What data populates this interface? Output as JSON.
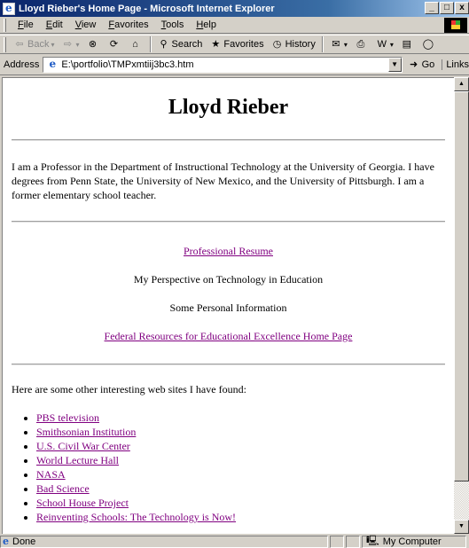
{
  "window": {
    "title": "Lloyd Rieber's Home Page - Microsoft Internet Explorer",
    "min": "_",
    "max": "□",
    "close": "x"
  },
  "menu": [
    "File",
    "Edit",
    "View",
    "Favorites",
    "Tools",
    "Help"
  ],
  "toolbar": {
    "back": "Back",
    "search": "Search",
    "favorites": "Favorites",
    "history": "History"
  },
  "address": {
    "label": "Address",
    "url": "E:\\portfolio\\TMPxmtiij3bc3.htm",
    "go": "Go",
    "links": "Links"
  },
  "page": {
    "heading": "Lloyd Rieber",
    "intro": "I am a Professor in the Department of Instructional Technology at the University of Georgia. I have degrees from Penn State, the University of New Mexico, and the University of Pittsburgh. I am a former elementary school teacher.",
    "center_items": [
      {
        "text": "Professional Resume",
        "link": true
      },
      {
        "text": "My Perspective on Technology in Education",
        "link": false
      },
      {
        "text": "Some Personal Information",
        "link": false
      },
      {
        "text": "Federal Resources for Educational Excellence Home Page",
        "link": true
      }
    ],
    "others_intro": "Here are some other interesting web sites I have found:",
    "sites": [
      "PBS television",
      "Smithsonian Institution",
      "U.S. Civil War Center",
      "World Lecture Hall",
      "NASA",
      "Bad Science",
      "School House Project",
      "Reinventing Schools: The Technology is Now!"
    ]
  },
  "status": {
    "text": "Done",
    "zone": "My Computer"
  },
  "colors": {
    "link_visited": "#800080",
    "titlebar": "#0a246a"
  }
}
